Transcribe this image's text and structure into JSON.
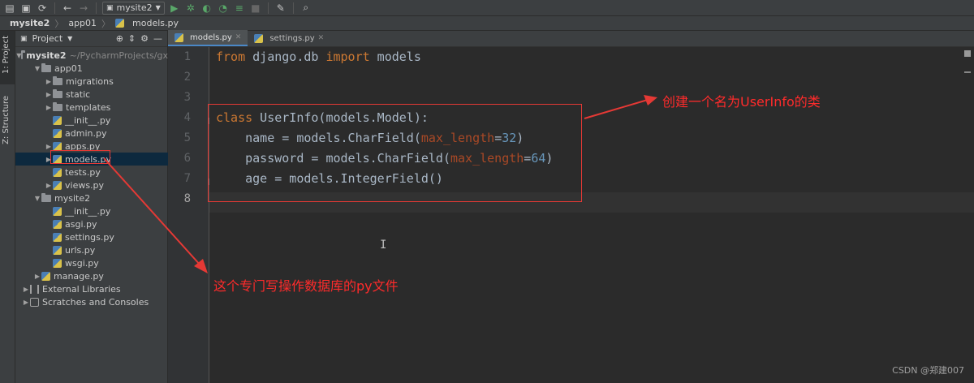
{
  "toolbar": {
    "run_config": "mysite2",
    "icons": [
      "open-folder-icon",
      "save-icon",
      "sync-icon",
      "back-icon",
      "forward-icon",
      "run-config-icon",
      "run-icon",
      "debug-icon",
      "coverage-icon",
      "profile-icon",
      "build-icon",
      "stop-icon",
      "wrench-icon",
      "search-icon"
    ]
  },
  "breadcrumb": [
    "mysite2",
    "app01",
    "models.py"
  ],
  "left_strip": {
    "project_label": "1: Project",
    "structure_label": "Z: Structure"
  },
  "project_panel": {
    "title": "Project",
    "tree": [
      {
        "label": "mysite2",
        "extra": "~/PycharmProjects/gx",
        "type": "folder",
        "expanded": true,
        "bold": true
      },
      {
        "label": "app01",
        "type": "folder",
        "expanded": true
      },
      {
        "label": "migrations",
        "type": "folder",
        "expanded": false
      },
      {
        "label": "static",
        "type": "folder",
        "expanded": false
      },
      {
        "label": "templates",
        "type": "folder",
        "expanded": false
      },
      {
        "label": "__init__.py",
        "type": "py"
      },
      {
        "label": "admin.py",
        "type": "py"
      },
      {
        "label": "apps.py",
        "type": "py",
        "expanded": false
      },
      {
        "label": "models.py",
        "type": "py",
        "expanded": false,
        "selected": true
      },
      {
        "label": "tests.py",
        "type": "py"
      },
      {
        "label": "views.py",
        "type": "py",
        "expanded": false
      },
      {
        "label": "mysite2",
        "type": "folder",
        "expanded": true
      },
      {
        "label": "__init__.py",
        "type": "py"
      },
      {
        "label": "asgi.py",
        "type": "py"
      },
      {
        "label": "settings.py",
        "type": "py"
      },
      {
        "label": "urls.py",
        "type": "py"
      },
      {
        "label": "wsgi.py",
        "type": "py"
      },
      {
        "label": "manage.py",
        "type": "py",
        "expanded": false
      },
      {
        "label": "External Libraries",
        "type": "lib",
        "expanded": false
      },
      {
        "label": "Scratches and Consoles",
        "type": "scratch",
        "expanded": false
      }
    ]
  },
  "tabs": [
    {
      "label": "models.py",
      "active": true
    },
    {
      "label": "settings.py",
      "active": false
    }
  ],
  "editor": {
    "line_numbers": [
      "1",
      "2",
      "3",
      "4",
      "5",
      "6",
      "7",
      "8"
    ],
    "current_line": "8",
    "lines": [
      [
        {
          "t": "from",
          "c": "kw"
        },
        {
          "t": " django.db ",
          "c": ""
        },
        {
          "t": "import",
          "c": "kw"
        },
        {
          "t": " models",
          "c": ""
        }
      ],
      [],
      [],
      [
        {
          "t": "class",
          "c": "kw"
        },
        {
          "t": " UserInfo(models.Model):",
          "c": ""
        }
      ],
      [
        {
          "t": "    name = models.CharField(",
          "c": ""
        },
        {
          "t": "max_length",
          "c": "param"
        },
        {
          "t": "=",
          "c": ""
        },
        {
          "t": "32",
          "c": "num"
        },
        {
          "t": ")",
          "c": ""
        }
      ],
      [
        {
          "t": "    password = models.CharField(",
          "c": ""
        },
        {
          "t": "max_length",
          "c": "param"
        },
        {
          "t": "=",
          "c": ""
        },
        {
          "t": "64",
          "c": "num"
        },
        {
          "t": ")",
          "c": ""
        }
      ],
      [
        {
          "t": "    age = models.IntegerField()",
          "c": ""
        }
      ],
      []
    ]
  },
  "annotations": {
    "class_note": "创建一个名为UserInfo的类",
    "file_note": "这个专门写操作数据库的py文件",
    "color": "#ff2b2b"
  },
  "watermark": "CSDN @郑建007"
}
